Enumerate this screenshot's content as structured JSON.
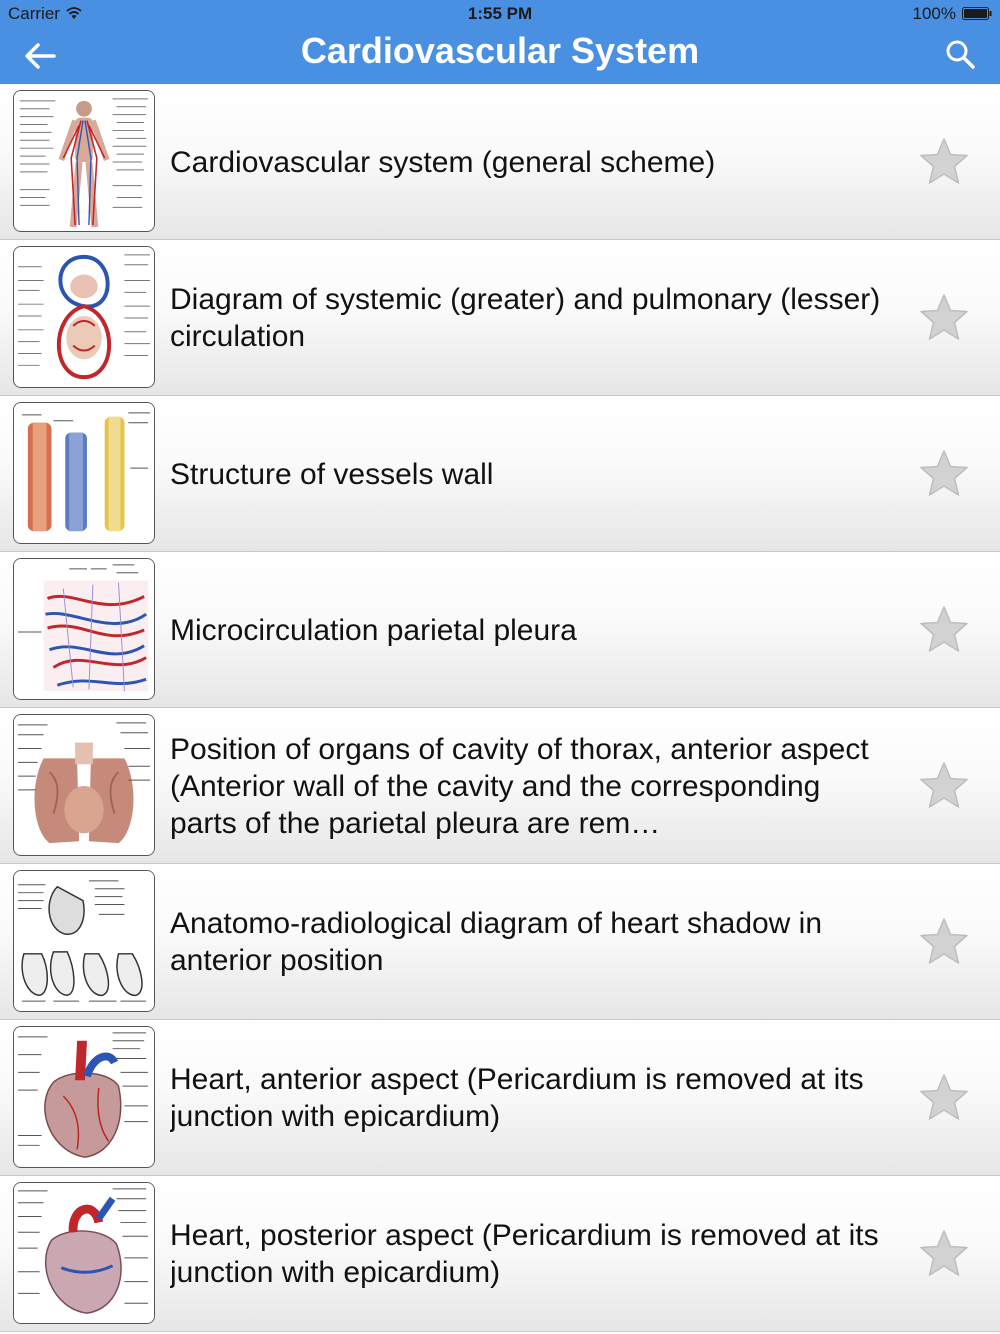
{
  "status_bar": {
    "carrier": "Carrier",
    "time": "1:55 PM",
    "battery": "100%"
  },
  "nav": {
    "title": "Cardiovascular System",
    "back_icon": "back-arrow-icon",
    "search_icon": "search-icon"
  },
  "colors": {
    "nav_background": "#4a90e2",
    "star_gray": "#c9c9c9"
  },
  "items": [
    {
      "title": "Cardiovascular system (general scheme)"
    },
    {
      "title": "Diagram of systemic (greater) and pulmonary (lesser) circulation"
    },
    {
      "title": "Structure of vessels wall"
    },
    {
      "title": "Microcirculation parietal pleura"
    },
    {
      "title": "Position of organs of cavity of thorax, anterior aspect (Anterior wall of the cavity and the corresponding parts of the parietal pleura are rem…"
    },
    {
      "title": "Anatomo-radiological diagram of heart shadow in anterior position"
    },
    {
      "title": "Heart, anterior aspect (Pericardium is removed at its junction with epicardium)"
    },
    {
      "title": "Heart, posterior aspect (Pericardium is removed at its junction with epicardium)"
    }
  ]
}
